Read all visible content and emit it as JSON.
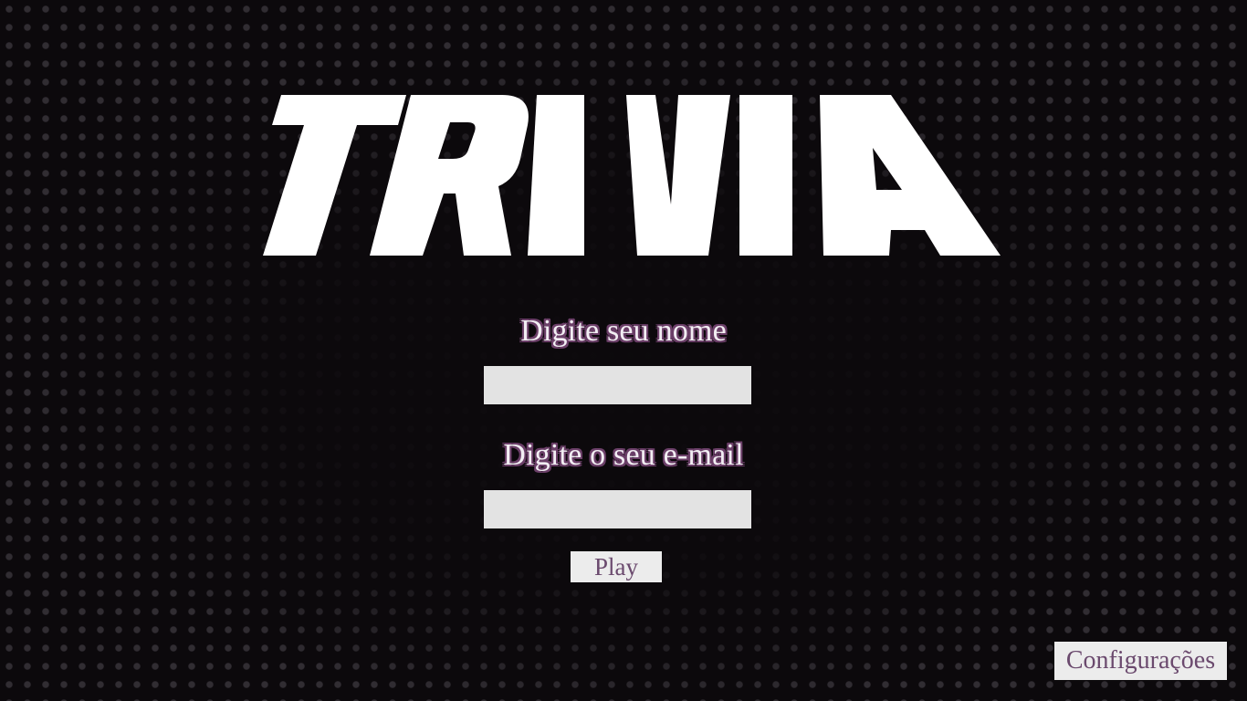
{
  "app": {
    "logo_text": "TRIVIA"
  },
  "login": {
    "name_label": "Digite seu nome",
    "name_value": "",
    "email_label": "Digite o seu e-mail",
    "email_value": "",
    "play_label": "Play"
  },
  "footer": {
    "settings_label": "Configurações"
  },
  "colors": {
    "background": "#0c090c",
    "logo": "#ffffff",
    "label_outline": "#6b3f68",
    "button_text": "#6b4a6e",
    "field_background": "#e3e3e3"
  }
}
